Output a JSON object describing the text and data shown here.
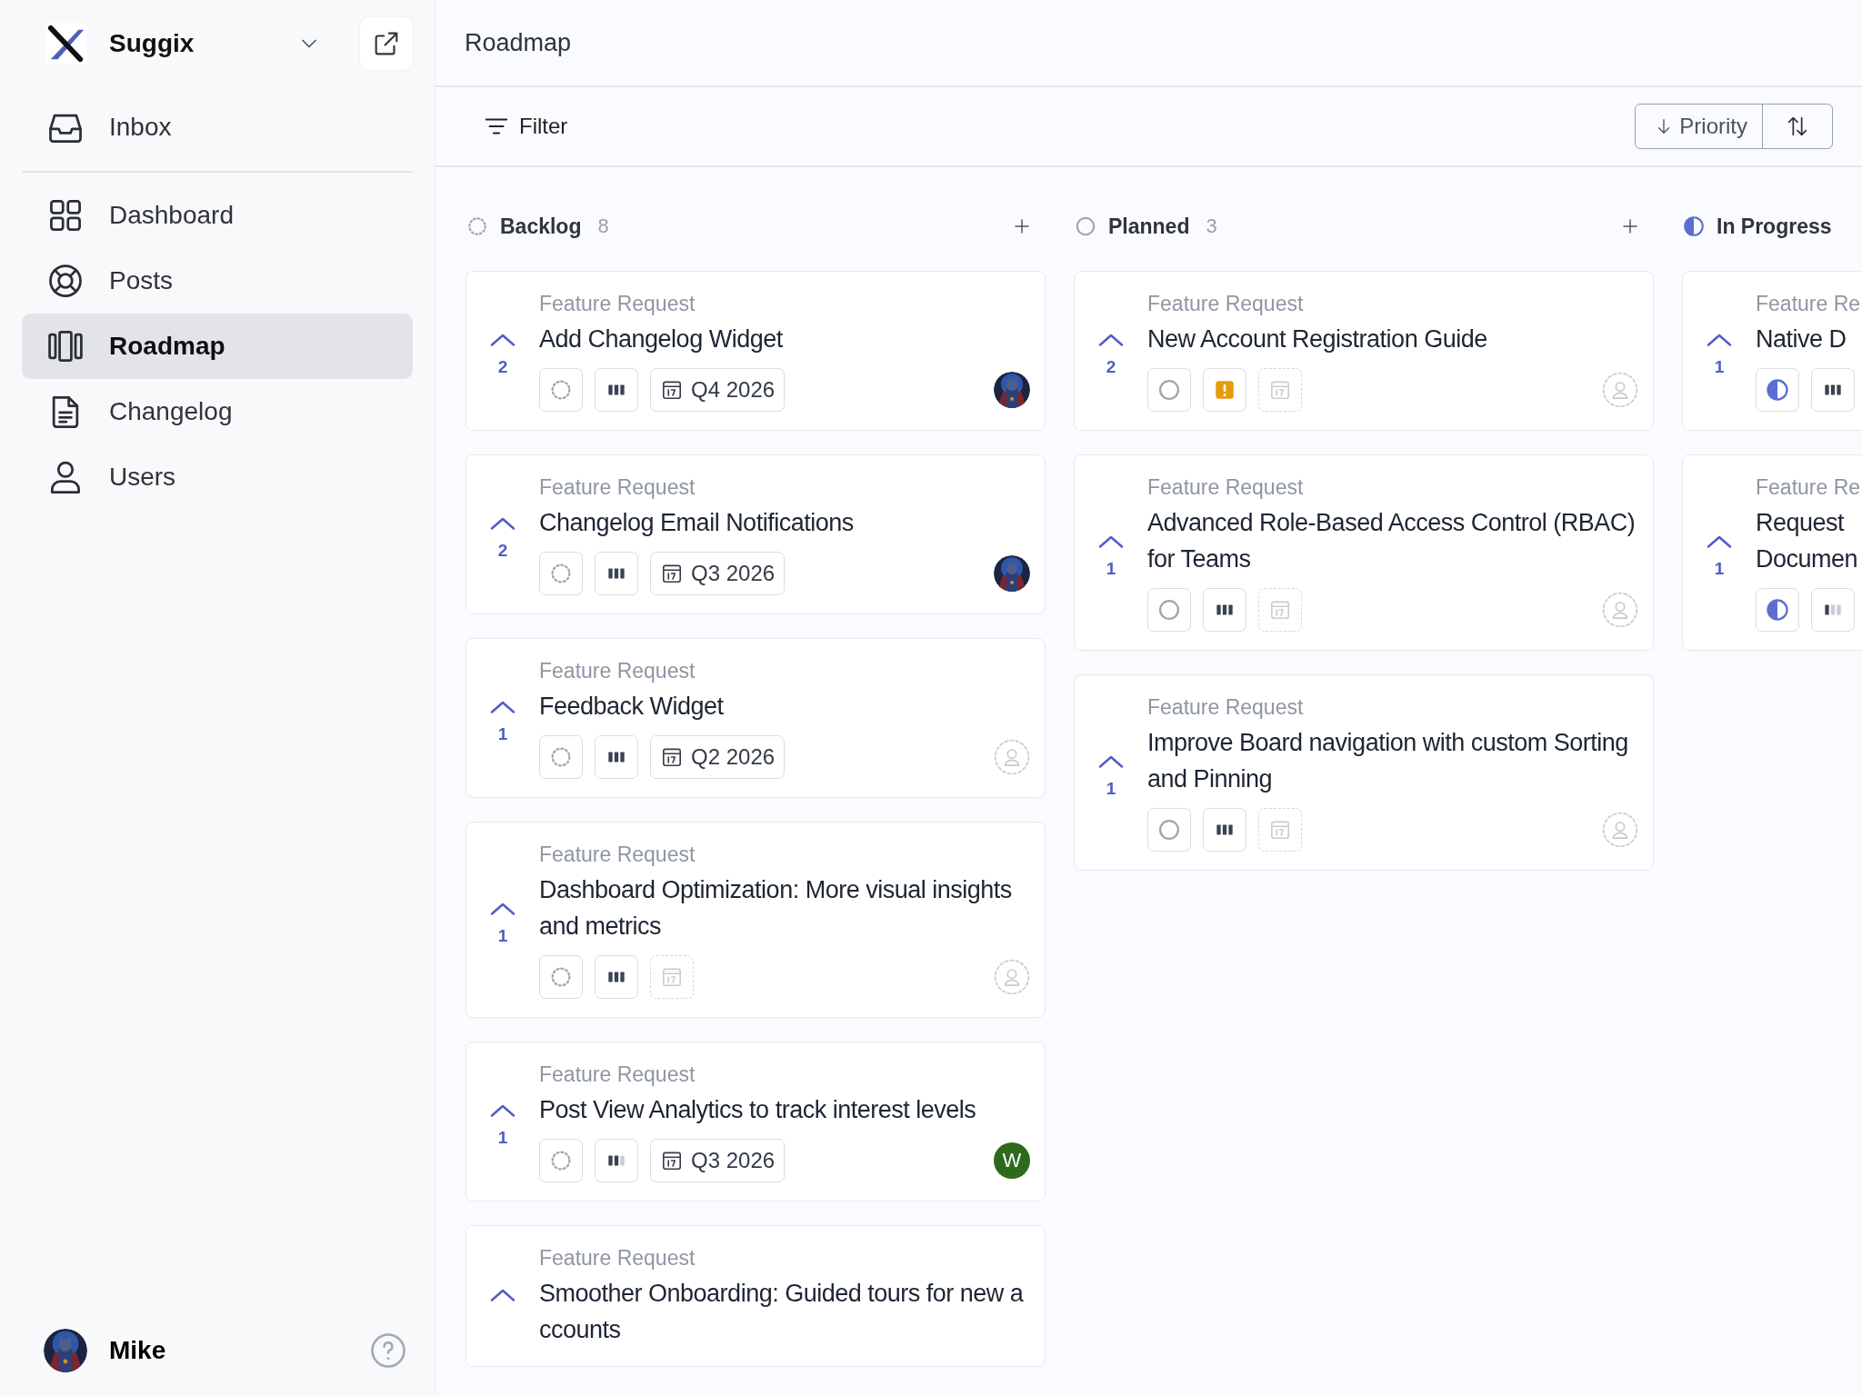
{
  "sidebar": {
    "workspace": "Suggix",
    "items": [
      {
        "label": "Inbox",
        "selected": false
      },
      {
        "label": "Dashboard",
        "selected": false
      },
      {
        "label": "Posts",
        "selected": false
      },
      {
        "label": "Roadmap",
        "selected": true
      },
      {
        "label": "Changelog",
        "selected": false
      },
      {
        "label": "Users",
        "selected": false
      }
    ],
    "user": {
      "name": "Mike"
    }
  },
  "header": {
    "title": "Roadmap"
  },
  "toolbar": {
    "filter": "Filter",
    "sort": "Priority"
  },
  "columns": [
    {
      "name": "Backlog",
      "kind": "backlog",
      "count": "8",
      "cards": [
        {
          "category": "Feature Request",
          "title": "Add Changelog Widget",
          "votes": "2",
          "priority": {
            "kind": "high"
          },
          "date": {
            "kind": "set",
            "label": "Q4 2026"
          }
        },
        {
          "category": "Feature Request",
          "title": "Changelog Email Notifications",
          "votes": "2",
          "priority": {
            "kind": "high"
          },
          "date": {
            "kind": "set",
            "label": "Q3 2026"
          }
        },
        {
          "category": "Feature Request",
          "title": "Feedback Widget",
          "votes": "1",
          "priority": {
            "kind": "high"
          },
          "date": {
            "kind": "set",
            "label": "Q2 2026"
          },
          "assignee": {
            "kind": "unassigned"
          }
        },
        {
          "category": "Feature Request",
          "title": "Dashboard Optimization: More visual insights and metrics",
          "votes": "1",
          "priority": {
            "kind": "high"
          },
          "date": {
            "kind": "unset"
          },
          "assignee": {
            "kind": "unassigned"
          }
        },
        {
          "category": "Feature Request",
          "title": "Post View Analytics to track interest levels",
          "votes": "1",
          "priority": {
            "kind": "medium"
          },
          "date": {
            "kind": "set",
            "label": "Q3 2026"
          },
          "assignee": {
            "kind": "letter",
            "initial": "W",
            "color": "#2e6a1c"
          }
        },
        {
          "category": "Feature Request",
          "title": "Smoother Onboarding: Guided tours for new accounts"
        }
      ]
    },
    {
      "name": "Planned",
      "kind": "planned",
      "count": "3",
      "cards": [
        {
          "category": "Feature Request",
          "title": "New Account Registration Guide",
          "votes": "2",
          "priority": {
            "kind": "urgent"
          },
          "date": {
            "kind": "unset"
          },
          "assignee": {
            "kind": "unassigned"
          }
        },
        {
          "category": "Feature Request",
          "title": "Advanced Role-Based Access Control (RBAC) for Teams",
          "votes": "1",
          "priority": {
            "kind": "high"
          },
          "date": {
            "kind": "unset"
          },
          "assignee": {
            "kind": "unassigned"
          }
        },
        {
          "category": "Feature Request",
          "title": "Improve Board navigation with custom Sorting and Pinning",
          "votes": "1",
          "priority": {
            "kind": "high"
          },
          "date": {
            "kind": "unset"
          },
          "assignee": {
            "kind": "unassigned"
          }
        }
      ]
    },
    {
      "name": "In Progress",
      "kind": "progress",
      "cards": [
        {
          "category": "Feature Re",
          "title": "Native D",
          "votes": "1",
          "priority": {
            "kind": "high"
          }
        },
        {
          "category": "Feature Re",
          "title": "Request Documen",
          "votes": "1",
          "priority": {
            "kind": "low"
          }
        }
      ]
    }
  ]
}
